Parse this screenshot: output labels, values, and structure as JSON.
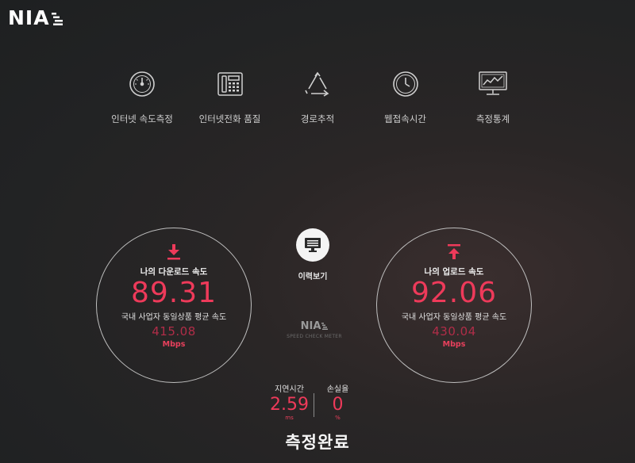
{
  "brand": {
    "logo": "NIA",
    "sub": "SPEED CHECK METER"
  },
  "menu": [
    {
      "label": "인터넷 속도측정",
      "icon": "speedometer-icon"
    },
    {
      "label": "인터넷전화 품질",
      "icon": "telephone-icon"
    },
    {
      "label": "경로추적",
      "icon": "recycle-route-icon"
    },
    {
      "label": "웹접속시간",
      "icon": "clock-icon"
    },
    {
      "label": "측정통계",
      "icon": "monitor-chart-icon"
    }
  ],
  "download": {
    "title": "나의 다운로드 속도",
    "value": "89.31",
    "avg_label": "국내 사업자 동일상품 평균 속도",
    "avg_value": "415.08",
    "unit": "Mbps"
  },
  "upload": {
    "title": "나의 업로드 속도",
    "value": "92.06",
    "avg_label": "국내 사업자 동일상품 평균 속도",
    "avg_value": "430.04",
    "unit": "Mbps"
  },
  "history": {
    "label": "이력보기"
  },
  "latency": {
    "label": "지연시간",
    "value": "2.59",
    "unit": "ms"
  },
  "loss": {
    "label": "손실율",
    "value": "0",
    "unit": "%"
  },
  "status": "측정완료",
  "colors": {
    "accent": "#ee3a5a",
    "avg": "#b02d48"
  }
}
